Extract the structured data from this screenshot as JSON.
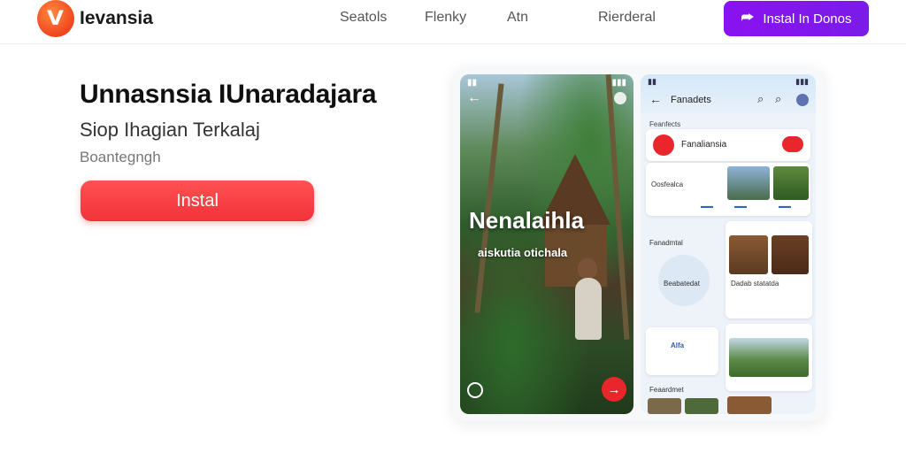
{
  "header": {
    "logo_glyph": "V",
    "brand": "Ievansia",
    "nav": [
      "Seatols",
      "Flenky",
      "Atn",
      "Rierderal"
    ],
    "install_button": "Instal In Donos",
    "install_icon": "share-arrow-icon"
  },
  "hero": {
    "title": "Unnasnsia IUnaradajara",
    "subtitle": "Siop Ihagian Terkalaj",
    "tagline": "Boantegngh",
    "install_button": "Instal"
  },
  "preview_left": {
    "title": "Nenalaihla",
    "subtitle": "aiskutia otichala"
  },
  "preview_right": {
    "header_title": "Fanadets",
    "section_label": "Feanfects",
    "profile_name": "Fanaliansia",
    "card1_title": "Oosfealca",
    "section2_label": "Fanadmtal",
    "circle_label": "Beabatedat",
    "card2_caption": "Dadab statatda",
    "pill_label": "Alfa",
    "bottom_label": "Feaardmet"
  },
  "colors": {
    "primary_red": "#f2323a",
    "purple": "#8a12f0",
    "logo_orange": "#f0451f"
  }
}
